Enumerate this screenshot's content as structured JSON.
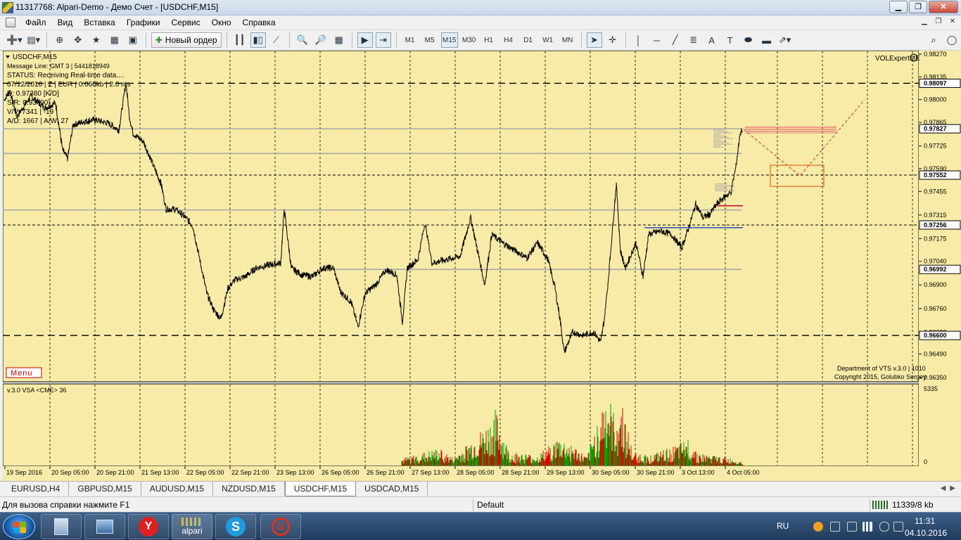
{
  "window": {
    "title": "11317768: Alpari-Demo - Демо Счет - [USDCHF,M15]",
    "minimize": "▁",
    "restore": "❐",
    "close": "✕"
  },
  "menu": [
    "Файл",
    "Вид",
    "Вставка",
    "Графики",
    "Сервис",
    "Окно",
    "Справка"
  ],
  "toolbar": {
    "new_order": "Новый ордер",
    "timeframes": [
      "M1",
      "M5",
      "M15",
      "M30",
      "H1",
      "H4",
      "D1",
      "W1",
      "MN"
    ],
    "active_timeframe": "M15",
    "text_tool": "A"
  },
  "chart": {
    "symbol": "USDCHF,M15",
    "info_lines": [
      "Message Line: GMT 3 | 5441818949",
      "STATUS:  Receiving Real-time data....",
      "07/12/2016 | Z | EUR | 0.060kb | 2.0 ms",
      "D: 0.97380 [K/D]",
      "S/R: 0.93 [90]",
      "V/V: 7341 | -19",
      "A/D: 1667 | A/W: 27"
    ],
    "expert_label": "VOLExpertME",
    "menu_button": "Menu",
    "credit_line1": "Department of VTS  v.3.0 | 1010",
    "credit_line2": "Copyright 2015, Golubko Sergey",
    "indicator_label": "v.3.0 VSA <CME> 36",
    "indicator_scale_max": "5335",
    "indicator_scale_min": "0",
    "price_ticks": [
      "0.98270",
      "0.98135",
      "0.98000",
      "0.97865",
      "0.97725",
      "0.97590",
      "0.97455",
      "0.97315",
      "0.97175",
      "0.97040",
      "0.96900",
      "0.96760",
      "0.96620",
      "0.96490",
      "0.96350"
    ],
    "highlighted_prices": [
      "0.98097",
      "0.97827",
      "0.97552",
      "0.97256",
      "0.96992",
      "0.96600"
    ],
    "time_labels": [
      "19 Sep 2016",
      "20 Sep 05:00",
      "20 Sep 21:00",
      "21 Sep 13:00",
      "22 Sep 05:00",
      "22 Sep 21:00",
      "23 Sep 13:00",
      "26 Sep 05:00",
      "26 Sep 21:00",
      "27 Sep 13:00",
      "28 Sep 05:00",
      "28 Sep 21:00",
      "29 Sep 13:00",
      "30 Sep 05:00",
      "30 Sep 21:00",
      "3 Oct 13:00",
      "4 Oct 05:00"
    ],
    "colors": {
      "background": "#f7eba7",
      "price_line": "#000000",
      "volume_up": "#00a000",
      "volume_down": "#e00000",
      "box": "#e05000"
    }
  },
  "tabs": [
    "EURUSD,H4",
    "GBPUSD,M15",
    "AUDUSD,M15",
    "NZDUSD,M15",
    "USDCHF,M15",
    "USDCAD,M15"
  ],
  "active_tab": "USDCHF,M15",
  "status": {
    "help": "Для вызова справки нажмите F1",
    "profile": "Default",
    "connection": "11339/8 kb"
  },
  "taskbar": {
    "apps": [
      "calculator-icon",
      "network-icon",
      "yandex-icon",
      "alpari-icon",
      "skype-icon",
      "gomez-icon"
    ],
    "alpari_label": "alpari",
    "lang": "RU",
    "time": "11:31",
    "date": "04.10.2016"
  }
}
